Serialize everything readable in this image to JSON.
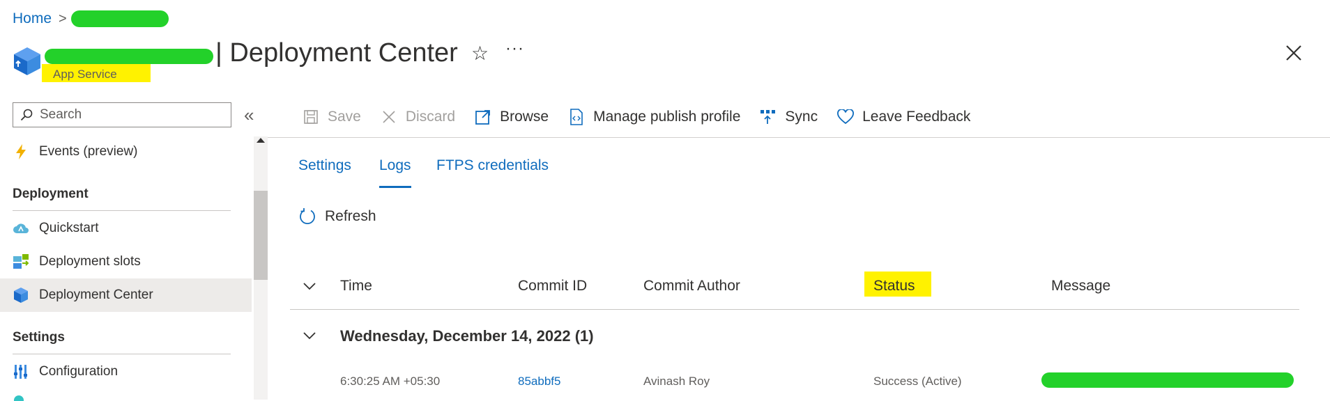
{
  "breadcrumb": {
    "home": "Home"
  },
  "header": {
    "title": "| Deployment Center",
    "subtitle": "App Service",
    "more": "···"
  },
  "sidebar": {
    "search_placeholder": "Search",
    "collapse": "«",
    "items_top": [
      {
        "label": "Events (preview)",
        "icon": "lightning-icon"
      }
    ],
    "sections": [
      {
        "label": "Deployment",
        "items": [
          {
            "label": "Quickstart",
            "icon": "cloud-icon"
          },
          {
            "label": "Deployment slots",
            "icon": "slots-icon"
          },
          {
            "label": "Deployment Center",
            "icon": "cube-icon",
            "active": true
          }
        ]
      },
      {
        "label": "Settings",
        "items": [
          {
            "label": "Configuration",
            "icon": "config-icon"
          }
        ]
      }
    ]
  },
  "toolbar": {
    "save": "Save",
    "discard": "Discard",
    "browse": "Browse",
    "manage_publish_profile": "Manage publish profile",
    "sync": "Sync",
    "leave_feedback": "Leave Feedback"
  },
  "tabs": [
    {
      "label": "Settings",
      "active": false
    },
    {
      "label": "Logs",
      "active": true
    },
    {
      "label": "FTPS credentials",
      "active": false
    }
  ],
  "refresh_label": "Refresh",
  "table": {
    "columns": [
      "Time",
      "Commit ID",
      "Commit Author",
      "Status",
      "Message"
    ],
    "group_title": "Wednesday, December 14, 2022 (1)",
    "rows": [
      {
        "time": "6:30:25 AM +05:30",
        "commit_id": "85abbf5",
        "commit_author": "Avinash Roy",
        "status": "Success (Active)"
      }
    ]
  },
  "colors": {
    "link_blue": "#0f6cbd",
    "highlight_yellow": "#fff200",
    "redaction_green": "#23d12a"
  }
}
